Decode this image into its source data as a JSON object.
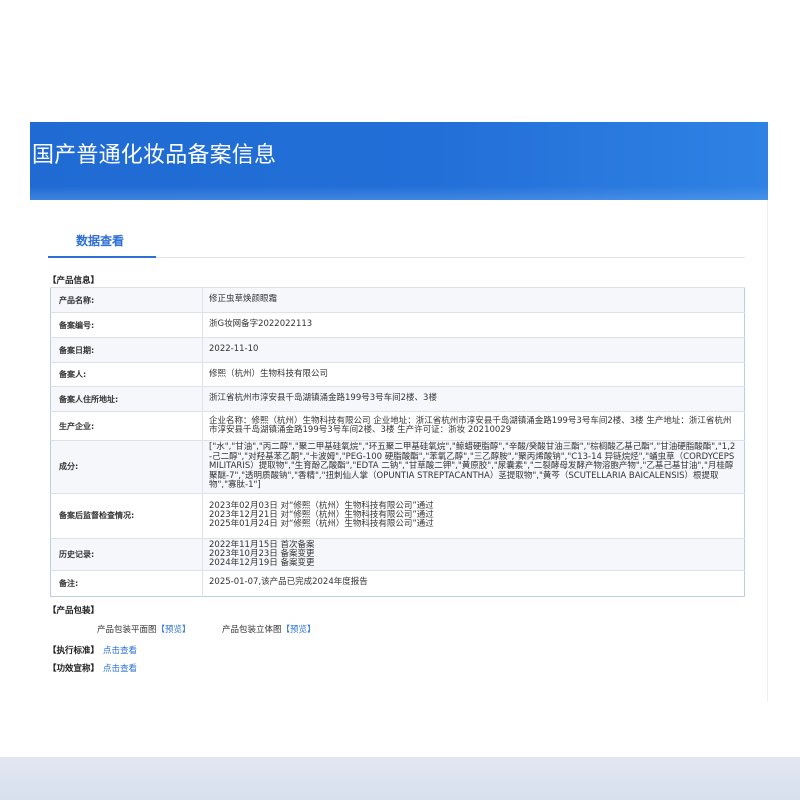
{
  "header": {
    "title": "国产普通化妆品备案信息"
  },
  "tabs": [
    {
      "label": "数据查看",
      "active": true
    }
  ],
  "product_info": {
    "section_title": "【产品信息】",
    "rows": [
      {
        "label": "产品名称:",
        "value": "修正虫草焕颜眼霜"
      },
      {
        "label": "备案编号:",
        "value": "浙G妆网备字2022022113"
      },
      {
        "label": "备案日期:",
        "value": "2022-11-10"
      },
      {
        "label": "备案人:",
        "value": "修熙（杭州）生物科技有限公司"
      },
      {
        "label": "备案人住所地址:",
        "value": "浙江省杭州市淳安县千岛湖镇涌金路199号3号车间2楼、3楼"
      },
      {
        "label": "生产企业:",
        "value": "企业名称：修熙（杭州）生物科技有限公司 企业地址：浙江省杭州市淳安县千岛湖镇涌金路199号3号车间2楼、3楼 生产地址：浙江省杭州市淳安县千岛湖镇涌金路199号3号车间2楼、3楼 生产许可证：浙妆 20210029"
      },
      {
        "label": "成分:",
        "value": "[\"水\",\"甘油\",\"丙二醇\",\"聚二甲基硅氧烷\",\"环五聚二甲基硅氧烷\",\"鲸蜡硬脂醇\",\"辛酸/癸酸甘油三酯\",\"棕榈酸乙基己酯\",\"甘油硬脂酸酯\",\"1,2-己二醇\",\"对羟基苯乙酮\",\"卡波姆\",\"PEG-100 硬脂酸酯\",\"苯氧乙醇\",\"三乙醇胺\",\"聚丙烯酸钠\",\"C13-14 异链烷烃\",\"蛹虫草（CORDYCEPS MILITARIS）提取物\",\"生育酚乙酸酯\",\"EDTA 二钠\",\"甘草酸二钾\",\"黄原胶\",\"尿囊素\",\"二裂酵母发酵产物溶胞产物\",\"乙基己基甘油\",\"月桂醇聚醚-7\",\"透明质酸钠\",\"香精\",\"扭刺仙人掌（OPUNTIA STREPTACANTHA）茎提取物\",\"黄芩（SCUTELLARIA BAICALENSIS）根提取物\",\"寡肽-1\"]"
      },
      {
        "label": "备案后监督检查情况:",
        "lines": [
          "2023年02月03日 对“修熙（杭州）生物科技有限公司”通过",
          "2023年12月21日 对“修熙（杭州）生物科技有限公司”通过",
          "2025年01月24日 对“修熙（杭州）生物科技有限公司”通过"
        ]
      },
      {
        "label": "历史记录:",
        "lines": [
          "2022年11月15日 首次备案",
          "2023年10月23日 备案变更",
          "2024年12月19日 备案变更"
        ]
      },
      {
        "label": "备注:",
        "value": "2025-01-07,该产品已完成2024年度报告"
      }
    ]
  },
  "packaging": {
    "section_title": "【产品包装】",
    "items": [
      {
        "label": "产品包装平面图",
        "link": "【预览】"
      },
      {
        "label": "产品包装立体图",
        "link": "【预览】"
      }
    ]
  },
  "execution_standard": {
    "section_title": "【执行标准】",
    "link": "点击查看"
  },
  "efficacy_claim": {
    "section_title": "【功效宣称】",
    "link": "点击查看"
  },
  "colors": {
    "banner": "#1f6bd3",
    "banner_light": "#2f82e4",
    "link": "#2a6fd6",
    "accent": "#2f6fd6",
    "footer": "#d8e0ee"
  }
}
